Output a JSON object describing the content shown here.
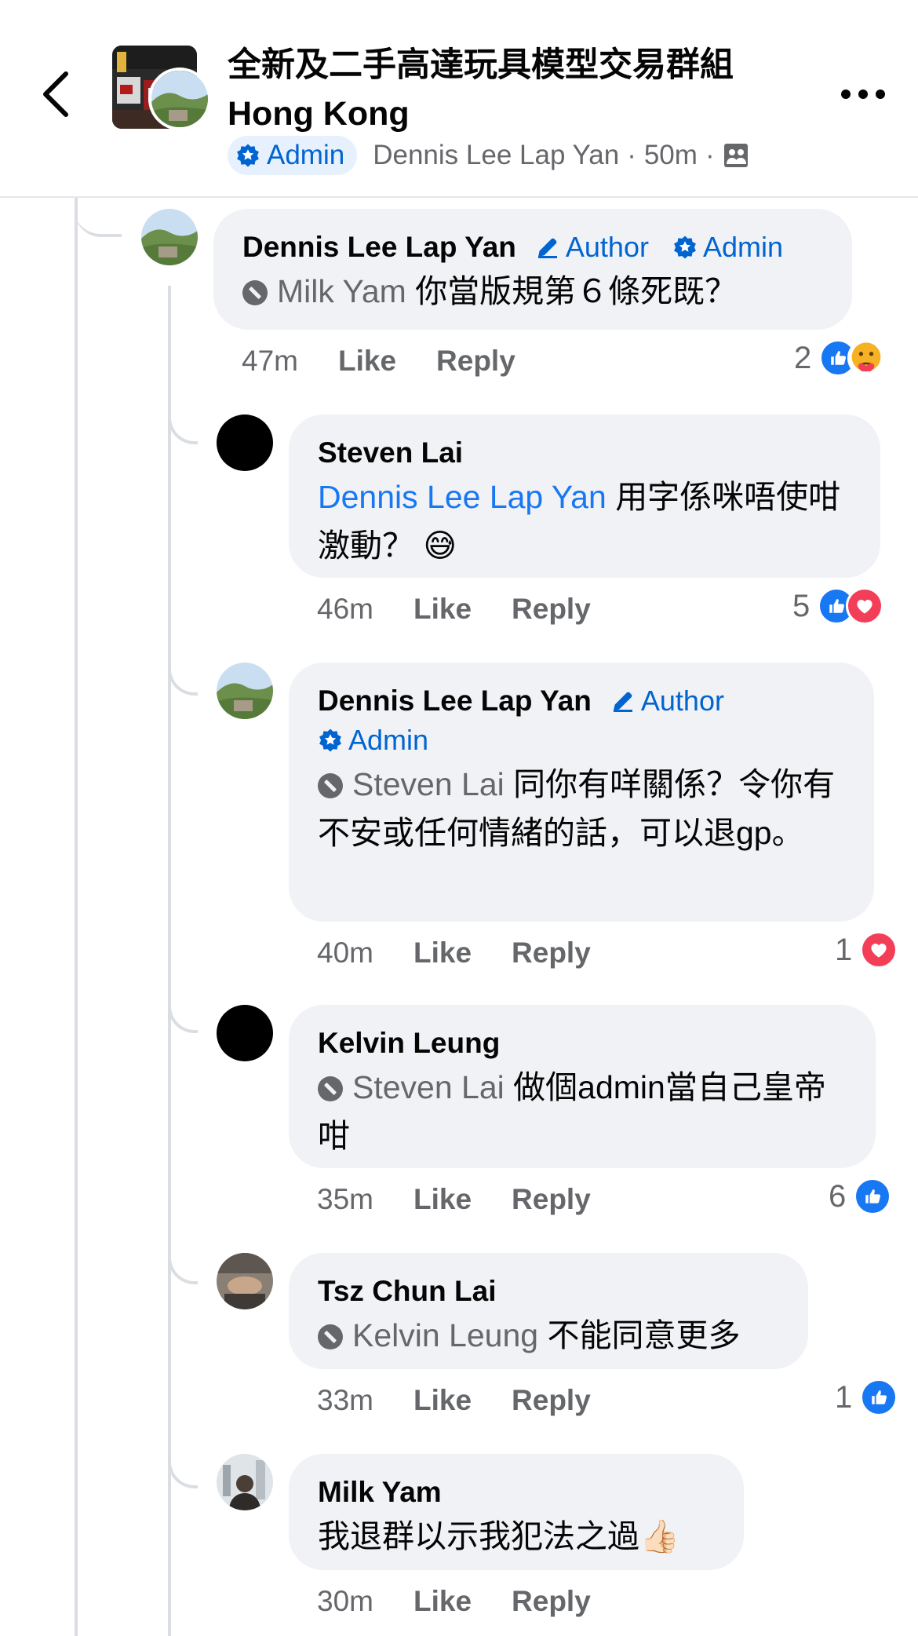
{
  "header": {
    "title": "全新及二手高達玩具模型交易群組 Hong Kong",
    "admin_badge": "Admin",
    "author": "Dennis Lee Lap Yan",
    "time": "50m",
    "dot": "·"
  },
  "labels": {
    "like": "Like",
    "reply": "Reply",
    "author_badge": "Author",
    "admin_badge": "Admin"
  },
  "comments": [
    {
      "name": "Dennis Lee Lap Yan",
      "mention": "Milk Yam",
      "text": "你當版規第６條死既？",
      "time": "47m",
      "reaction_count": "2",
      "reactions": [
        "like",
        "care"
      ]
    },
    {
      "name": "Steven Lai",
      "mention": "Dennis Lee Lap Yan",
      "text": "用字係咪唔使咁激動？ 😅",
      "time": "46m",
      "reaction_count": "5",
      "reactions": [
        "like",
        "love"
      ]
    },
    {
      "name": "Dennis Lee Lap Yan",
      "mention": "Steven Lai",
      "text": "同你有咩關係？令你有不安或任何情緒的話，可以退gp。",
      "time": "40m",
      "reaction_count": "1",
      "reactions": [
        "love"
      ]
    },
    {
      "name": "Kelvin Leung",
      "mention": "Steven Lai",
      "text": "做個admin當自己皇帝咁",
      "time": "35m",
      "reaction_count": "6",
      "reactions": [
        "like"
      ]
    },
    {
      "name": "Tsz Chun Lai",
      "mention": "Kelvin Leung",
      "text": "不能同意更多",
      "time": "33m",
      "reaction_count": "1",
      "reactions": [
        "like"
      ]
    },
    {
      "name": "Milk Yam",
      "text": "我退群以示我犯法之過👍🏻",
      "time": "30m"
    }
  ],
  "icons": {
    "back": "chevron-left-icon",
    "more": "more-dots-icon",
    "admin": "star-badge-icon",
    "author": "pencil-icon",
    "restricted": "restricted-icon",
    "audience": "members-icon"
  },
  "colors": {
    "accent": "#1877f2",
    "badge_text": "#0064d1",
    "bubble": "#f0f2f5",
    "secondary_text": "#65676b",
    "love": "#f33e58"
  }
}
